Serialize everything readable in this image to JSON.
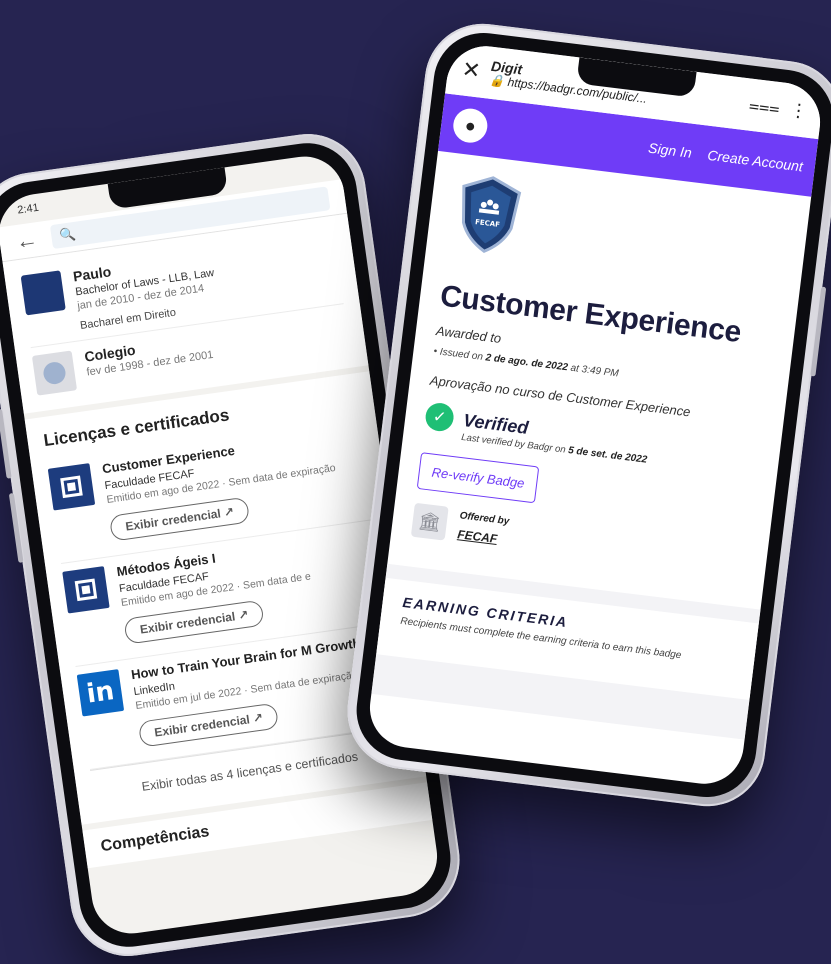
{
  "left_phone": {
    "status_time": "2:41",
    "education": [
      {
        "title": "Paulo",
        "degree": "Bachelor of Laws - LLB, Law",
        "date": "jan de 2010 - dez de 2014",
        "description": "Bacharel em Direito"
      },
      {
        "title": "Colegio",
        "degree": "",
        "date": "fev de 1998 - dez de 2001",
        "description": ""
      }
    ],
    "licenses_title": "Licenças e certificados",
    "licenses": [
      {
        "title": "Customer Experience",
        "org": "Faculdade FECAF",
        "date": "Emitido em ago de 2022 · Sem data de expiração",
        "button": "Exibir credencial"
      },
      {
        "title": "Métodos Ágeis I",
        "org": "Faculdade FECAF",
        "date": "Emitido em ago de 2022 · Sem data de e",
        "button": "Exibir credencial"
      },
      {
        "title": "How to Train Your Brain for M Growth",
        "org": "LinkedIn",
        "date": "Emitido em jul de 2022 · Sem data de expiraçã",
        "button": "Exibir credencial"
      }
    ],
    "show_all": "Exibir todas as 4 licenças e certificados",
    "next_section": "Competências",
    "external_link_glyph": "↗"
  },
  "right_phone": {
    "browser_title": "Digit",
    "browser_url": "https://badgr.com/public/...",
    "nav": {
      "sign_in": "Sign In",
      "create_account": "Create Account"
    },
    "badge_name": "Customer Experience",
    "badge_org_label": "FECAF",
    "awarded_to": "Awarded to",
    "issued_prefix": "Issued on",
    "issued_date": "2 de ago. de 2022",
    "issued_time": "at 3:49 PM",
    "description": "Aprovação no curso de Customer Experience",
    "verified_title": "Verified",
    "verified_prefix": "Last verified by Badgr on",
    "verified_date": "5 de set. de 2022",
    "reverify_button": "Re-verify Badge",
    "offered_by": "Offered by",
    "offered_org": "FECAF",
    "earning_title": "EARNING CRITERIA",
    "earning_sub": "Recipients must complete the earning criteria to earn this badge"
  },
  "colors": {
    "background": "#262451",
    "badgr_purple": "#6f3cf7",
    "verified_green": "#1fbf75",
    "linkedin_blue": "#0a66c2"
  }
}
